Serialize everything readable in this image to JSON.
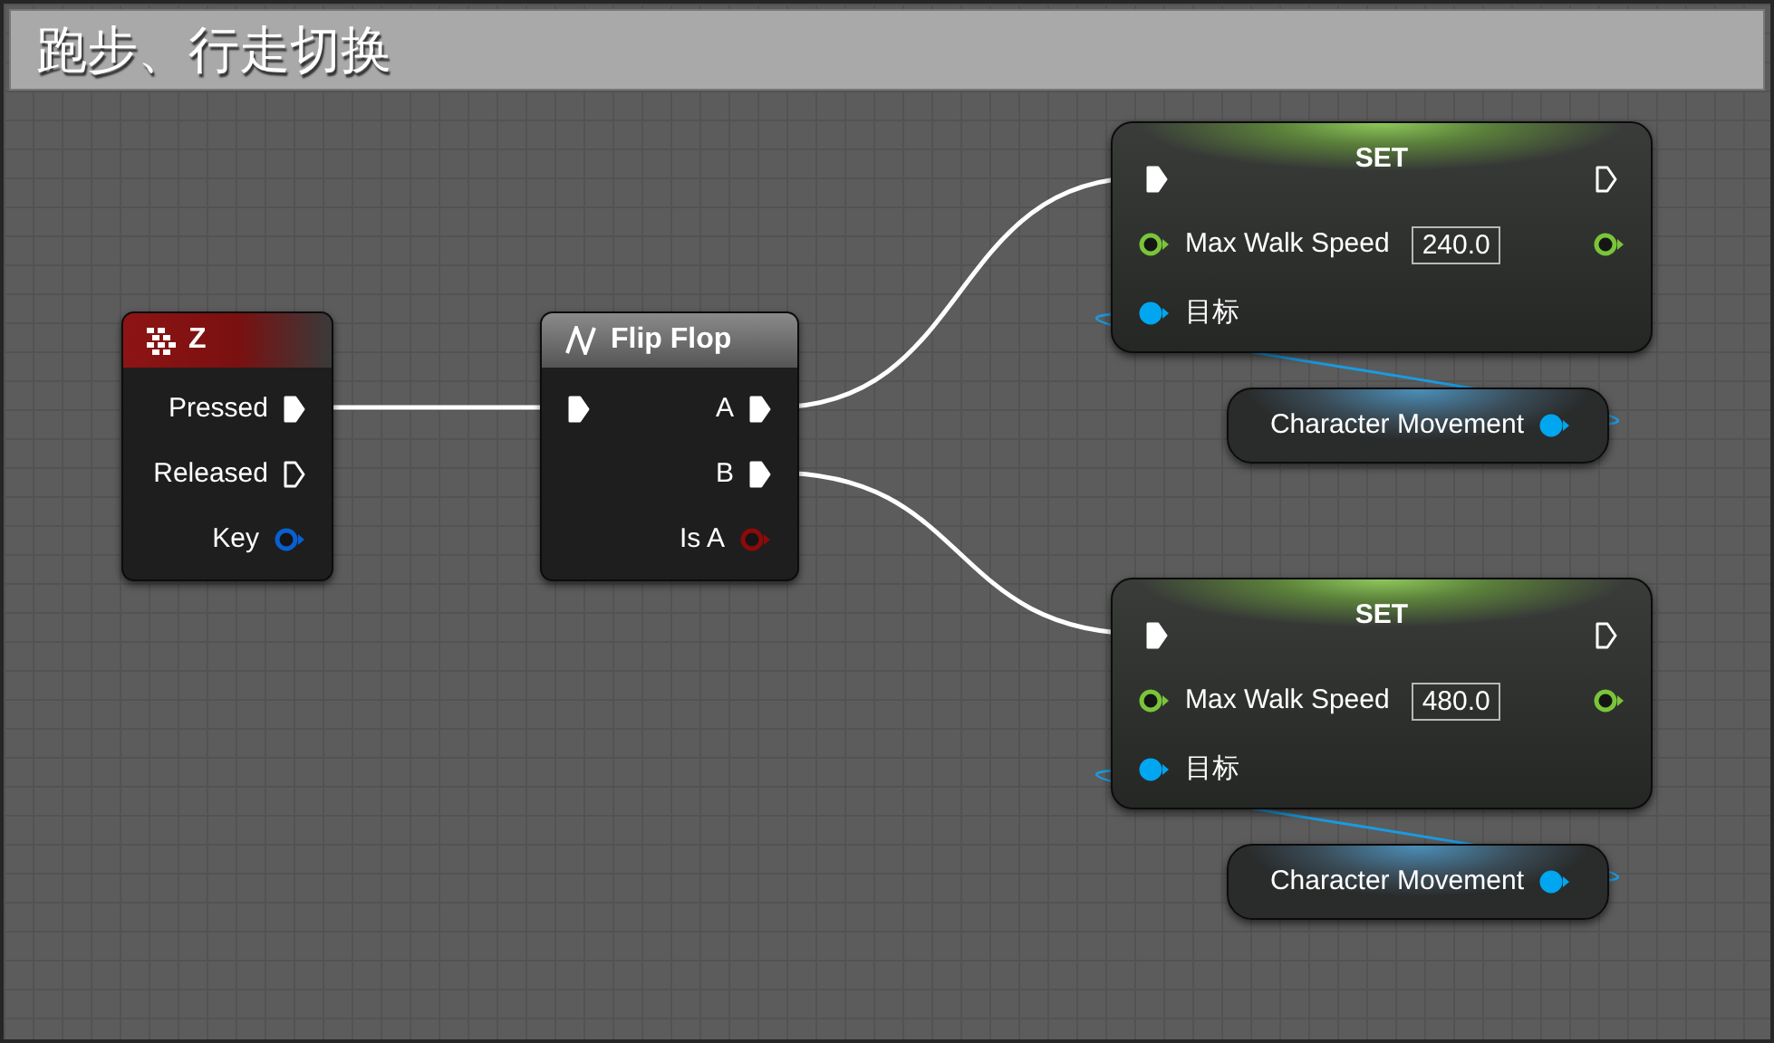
{
  "comment": {
    "title": "跑步、行走切换"
  },
  "nodes": [
    {
      "kind": "event",
      "title": "Z",
      "outputs": [
        {
          "label": "Pressed",
          "kind": "exec",
          "connected": true
        },
        {
          "label": "Released",
          "kind": "exec",
          "connected": false
        },
        {
          "label": "Key",
          "kind": "data",
          "color": "#0a5fd0",
          "connected": false
        }
      ]
    },
    {
      "kind": "macro",
      "title": "Flip Flop",
      "inputs": [
        {
          "kind": "exec",
          "connected": true
        }
      ],
      "outputs": [
        {
          "label": "A",
          "kind": "exec",
          "connected": true
        },
        {
          "label": "B",
          "kind": "exec",
          "connected": true
        },
        {
          "label": "Is A",
          "kind": "data",
          "color": "#8c0a0a",
          "connected": false
        }
      ]
    },
    {
      "kind": "setter",
      "title": "SET",
      "inputs": [
        {
          "kind": "exec",
          "connected": true
        },
        {
          "label": "Max Walk Speed",
          "kind": "data",
          "color": "#7ac43a",
          "connected": false,
          "value": "240.0"
        },
        {
          "label": "目标",
          "kind": "data",
          "color": "#00a6f0",
          "connected": true
        }
      ],
      "outputs": [
        {
          "kind": "exec",
          "connected": false
        },
        {
          "kind": "data",
          "color": "#7ac43a",
          "connected": false
        }
      ]
    },
    {
      "kind": "variable",
      "title": "Character Movement",
      "outputs": [
        {
          "kind": "data",
          "color": "#00a6f0",
          "connected": true
        }
      ]
    },
    {
      "kind": "setter",
      "title": "SET",
      "inputs": [
        {
          "kind": "exec",
          "connected": true
        },
        {
          "label": "Max Walk Speed",
          "kind": "data",
          "color": "#7ac43a",
          "connected": false,
          "value": "480.0"
        },
        {
          "label": "目标",
          "kind": "data",
          "color": "#00a6f0",
          "connected": true
        }
      ],
      "outputs": [
        {
          "kind": "exec",
          "connected": false
        },
        {
          "kind": "data",
          "color": "#7ac43a",
          "connected": false
        }
      ]
    },
    {
      "kind": "variable",
      "title": "Character Movement",
      "outputs": [
        {
          "kind": "data",
          "color": "#00a6f0",
          "connected": true
        }
      ]
    }
  ]
}
